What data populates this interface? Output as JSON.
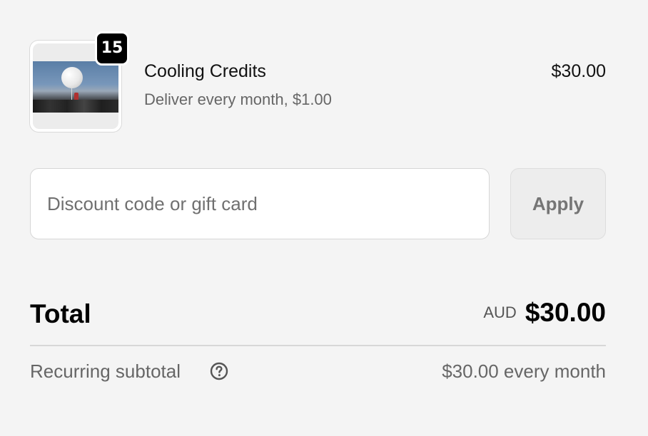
{
  "line_item": {
    "quantity": "15",
    "name": "Cooling Credits",
    "subtitle": "Deliver every month, $1.00",
    "price": "$30.00",
    "image_icon": "product-photo"
  },
  "discount": {
    "placeholder": "Discount code or gift card",
    "value": "",
    "apply_label": "Apply"
  },
  "totals": {
    "total_label": "Total",
    "currency": "AUD",
    "total_amount": "$30.00",
    "recurring_label": "Recurring subtotal",
    "recurring_value": "$30.00 every month",
    "help_icon": "question-circle-icon"
  },
  "colors": {
    "background": "#f4f4f4",
    "badge": "#000000",
    "muted_text": "#666666",
    "apply_button_bg": "#ededed"
  }
}
